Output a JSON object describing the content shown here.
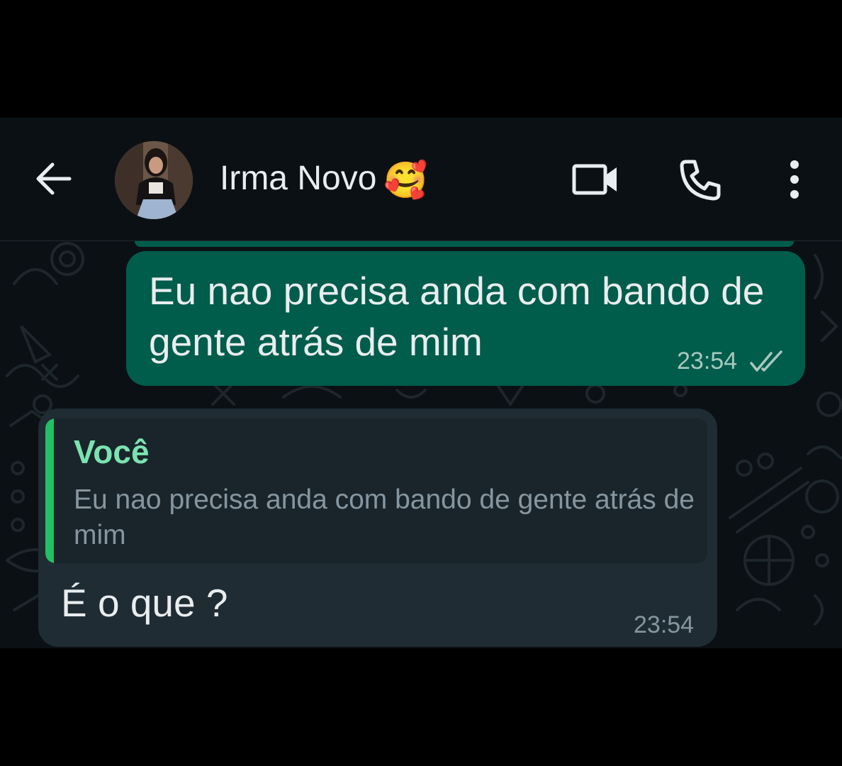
{
  "header": {
    "contact_name": "Irma Novo",
    "contact_emoji": "🥰",
    "back_icon": "arrow-left-icon",
    "video_icon": "video-camera-icon",
    "call_icon": "phone-icon",
    "menu_icon": "more-vertical-icon"
  },
  "messages": {
    "outgoing": {
      "text": "Eu nao precisa anda com bando de gente atrás de mim",
      "time": "23:54",
      "status_icon": "double-check-icon"
    },
    "incoming": {
      "quote_author": "Você",
      "quote_text": "Eu nao precisa anda com bando de gente atrás de mim",
      "text": "É o que ?",
      "time": "23:54"
    }
  },
  "colors": {
    "outgoing_bubble": "#005c4b",
    "incoming_bubble": "#1f2c33",
    "quote_accent": "#21c063",
    "quote_author": "#7ae3b0",
    "background": "#0b1014"
  }
}
